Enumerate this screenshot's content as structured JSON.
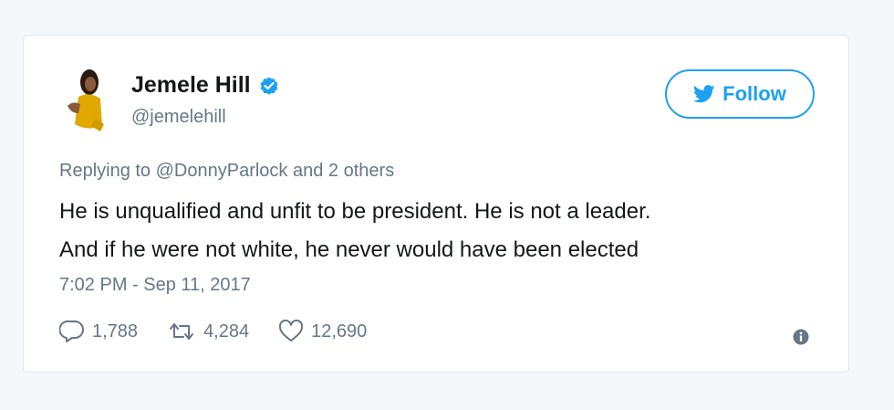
{
  "tweet": {
    "display_name": "Jemele Hill",
    "handle": "@jemelehill",
    "follow_label": "Follow",
    "replying_prefix": "Replying to",
    "replying_mention": "@DonnyParlock",
    "replying_suffix": "and 2 others",
    "text_line1": "He is unqualified and unfit to be president. He is not a leader.",
    "text_line2": "And if he were not white, he never would have been elected",
    "timestamp": "7:02 PM - Sep 11, 2017",
    "replies": "1,788",
    "retweets": "4,284",
    "likes": "12,690"
  },
  "icons": {
    "verified": "verified-badge-icon",
    "bird": "twitter-bird-icon",
    "reply": "reply-icon",
    "retweet": "retweet-icon",
    "like": "heart-icon",
    "info": "info-icon"
  },
  "colors": {
    "accent": "#1da1f2",
    "text": "#14171a",
    "muted": "#657786",
    "border": "#e1e8ed"
  }
}
